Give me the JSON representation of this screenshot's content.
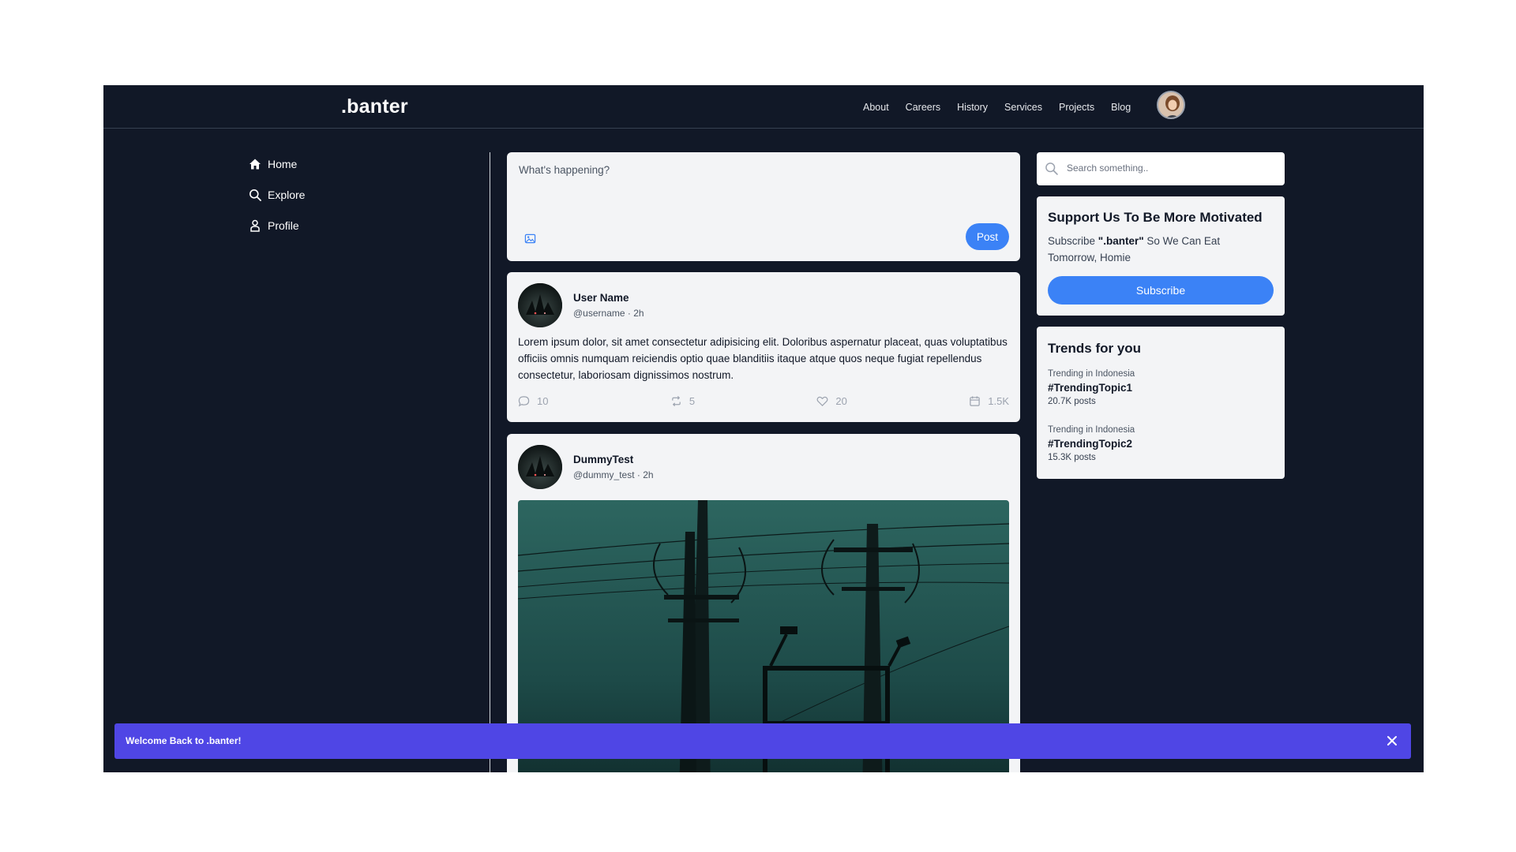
{
  "brand": {
    "name": ".banter"
  },
  "nav": [
    "About",
    "Careers",
    "History",
    "Services",
    "Projects",
    "Blog"
  ],
  "sidebar": [
    {
      "label": "Home",
      "icon": "home-icon"
    },
    {
      "label": "Explore",
      "icon": "search-icon"
    },
    {
      "label": "Profile",
      "icon": "user-icon"
    }
  ],
  "composer": {
    "placeholder": "What's happening?",
    "post_label": "Post"
  },
  "posts": [
    {
      "name": "User Name",
      "meta": "@username · 2h",
      "text": "Lorem ipsum dolor, sit amet consectetur adipisicing elit. Doloribus aspernatur placeat, quas voluptatibus officiis omnis numquam reiciendis optio quae blanditiis itaque atque quos neque fugiat repellendus consectetur, laboriosam dignissimos nostrum.",
      "comments": "10",
      "reposts": "5",
      "likes": "20",
      "views": "1.5K"
    },
    {
      "name": "DummyTest",
      "meta": "@dummy_test · 2h"
    }
  ],
  "search": {
    "placeholder": "Search something.."
  },
  "support": {
    "title": "Support Us To Be More Motivated",
    "text_pre": "Subscribe ",
    "text_brand": "\".banter\"",
    "text_post": " So We Can Eat Tomorrow, Homie",
    "button": "Subscribe"
  },
  "trends": {
    "title": "Trends for you",
    "items": [
      {
        "location": "Trending in Indonesia",
        "tag": "#TrendingTopic1",
        "count": "20.7K posts"
      },
      {
        "location": "Trending in Indonesia",
        "tag": "#TrendingTopic2",
        "count": "15.3K posts"
      }
    ]
  },
  "toast": {
    "message": "Welcome Back to .banter!"
  },
  "colors": {
    "background": "#111827",
    "card": "#f3f4f6",
    "accent": "#3b82f6",
    "toast": "#4f46e5"
  }
}
